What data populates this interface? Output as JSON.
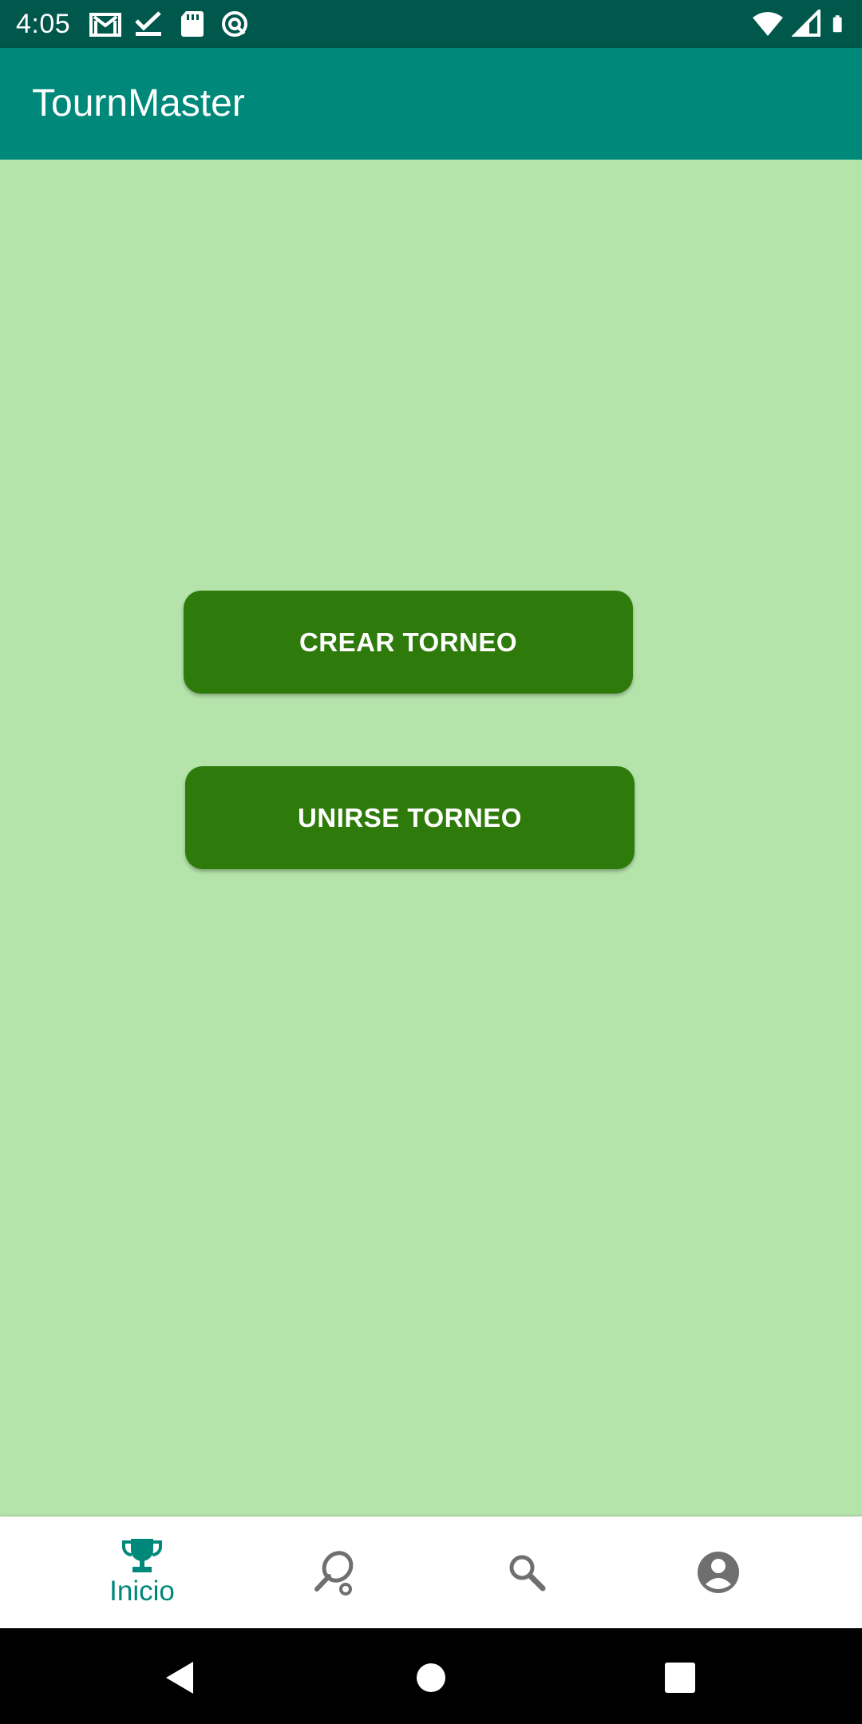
{
  "status_bar": {
    "time": "4:05",
    "left_icons": [
      "gmail-icon",
      "checkmark-icon",
      "sd-card-icon",
      "no-tracking-icon"
    ],
    "right_icons": [
      "wifi-icon",
      "cell-signal-icon",
      "battery-icon"
    ]
  },
  "app_bar": {
    "title": "TournMaster"
  },
  "main": {
    "create_button_label": "CREAR TORNEO",
    "join_button_label": "UNIRSE TORNEO"
  },
  "bottom_nav": {
    "items": [
      {
        "label": "Inicio",
        "icon": "trophy-icon",
        "active": true
      },
      {
        "label": "",
        "icon": "racket-icon",
        "active": false
      },
      {
        "label": "",
        "icon": "search-icon",
        "active": false
      },
      {
        "label": "",
        "icon": "account-icon",
        "active": false
      }
    ]
  },
  "system_nav": {
    "buttons": [
      "back-icon",
      "home-icon",
      "recents-icon"
    ]
  },
  "colors": {
    "status_bar": "#00574b",
    "app_bar": "#00887a",
    "background": "#b5e4ab",
    "button": "#2e7a0b",
    "active_nav": "#00887a",
    "inactive_nav": "#6f6f6f"
  }
}
